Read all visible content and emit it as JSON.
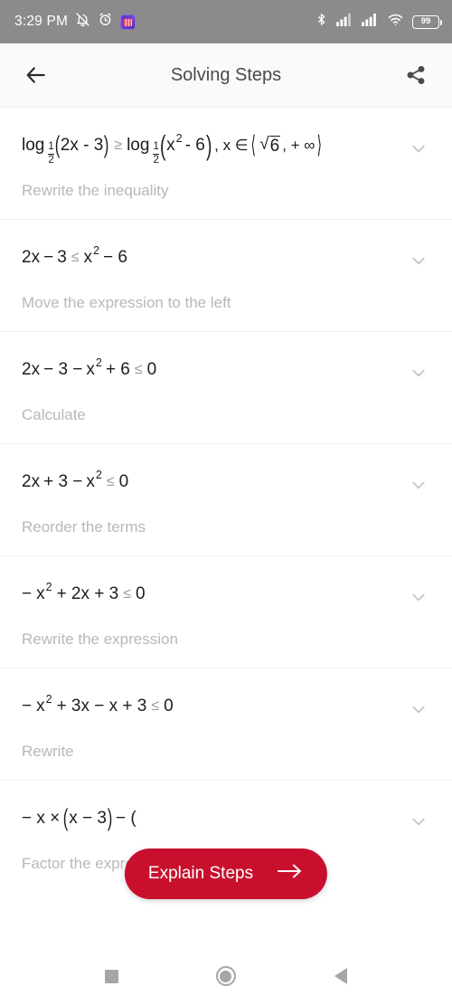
{
  "statusbar": {
    "time": "3:29 PM",
    "icons": [
      "bell-muted-icon",
      "alarm-clock-icon",
      "app-badge-icon"
    ],
    "right_icons": [
      "bluetooth-icon",
      "signal-1-icon",
      "signal-2-icon",
      "wifi-icon"
    ],
    "battery_level": "99"
  },
  "appbar": {
    "back_label": "Back",
    "title": "Solving Steps",
    "share_label": "Share"
  },
  "steps": [
    {
      "caption": "Rewrite the inequality",
      "equation_text": "log_(1/2)(2x - 3) ≥ log_(1/2)(x² - 6) , x ∈ ⟨√6 , + ∞⟩",
      "parts": {
        "log1": "log",
        "base1_num": "1",
        "base1_den": "2",
        "arg1": "2x - 3",
        "relation": "≥",
        "log2": "log",
        "base2_num": "1",
        "base2_den": "2",
        "arg2_base": "x",
        "arg2_exp": "2",
        "arg2_rest": "- 6",
        "domain_prefix": ", x ∈",
        "domain_root": "6",
        "domain_rest": ", + ∞"
      }
    },
    {
      "caption": "Move the expression to the left",
      "equation_text": "2x - 3 ≤ x² - 6",
      "parts": {
        "lhs": "2x",
        "lhs_op": "−",
        "lhs_num": "3",
        "relation": "≤",
        "rhs_base": "x",
        "rhs_exp": "2",
        "rhs_rest": "− 6"
      }
    },
    {
      "caption": "Calculate",
      "equation_text": "2x - 3 - x² + 6 ≤ 0",
      "parts": {
        "a": "2x",
        "b": "− 3 −",
        "base": "x",
        "exp": "2",
        "c": "+ 6",
        "relation": "≤",
        "rhs": "0"
      }
    },
    {
      "caption": "Reorder the terms",
      "equation_text": "2x + 3 - x² ≤ 0",
      "parts": {
        "a": "2x",
        "b": "+ 3 −",
        "base": "x",
        "exp": "2",
        "c": "",
        "relation": "≤",
        "rhs": "0"
      }
    },
    {
      "caption": "Rewrite the expression",
      "equation_text": "- x² + 2x + 3 ≤ 0",
      "parts": {
        "a": "−",
        "b": "",
        "base": "x",
        "exp": "2",
        "c": "+ 2x + 3",
        "relation": "≤",
        "rhs": "0"
      }
    },
    {
      "caption": "Rewrite",
      "equation_text": "- x² + 3x - x + 3 ≤ 0",
      "parts": {
        "a": "−",
        "b": "",
        "base": "x",
        "exp": "2",
        "c": "+ 3x − x + 3",
        "relation": "≤",
        "rhs": "0"
      }
    },
    {
      "caption": "Factor the expression",
      "equation_text": "- x × (x - 3) - (",
      "parts": {
        "a": "− x ×",
        "open": "(",
        "inner": "x − 3",
        "close": ")",
        "tail": "− ("
      }
    }
  ],
  "expand_icon": "chevron-down-icon",
  "fab": {
    "label": "Explain Steps",
    "arrow_icon": "arrow-right-icon",
    "color": "#c8102e"
  },
  "navbar": {
    "recents_label": "Recents",
    "home_label": "Home",
    "back_label": "Back"
  }
}
